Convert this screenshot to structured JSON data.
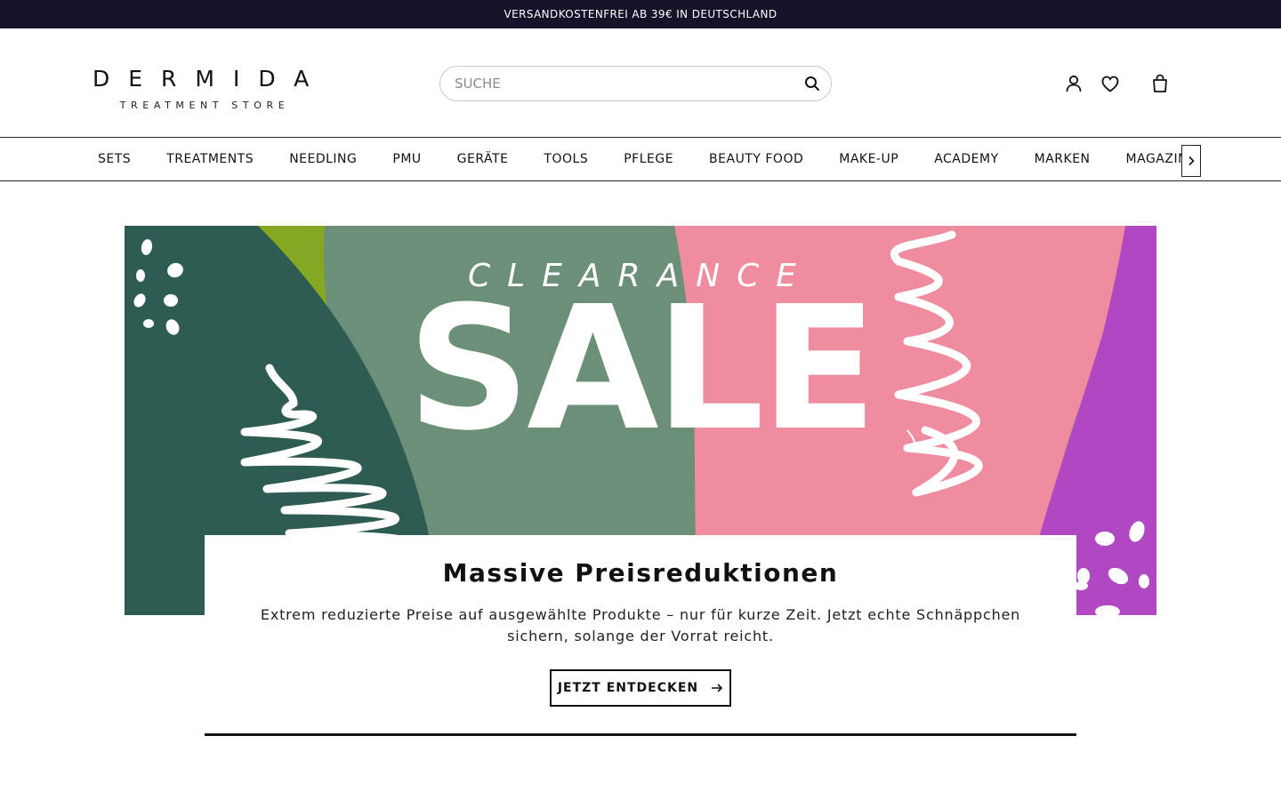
{
  "topbar": {
    "text": "VERSANDKOSTENFREI AB 39€ IN DEUTSCHLAND"
  },
  "logo": {
    "main": "DERMIDA",
    "sub": "TREATMENT STORE"
  },
  "search": {
    "placeholder": "SUCHE",
    "value": "",
    "icon": "search-icon"
  },
  "header_icons": [
    "user-icon",
    "heart-icon",
    "cart-icon"
  ],
  "nav": {
    "items": [
      "SETS",
      "TREATMENTS",
      "NEEDLING",
      "PMU",
      "GERÄTE",
      "TOOLS",
      "PFLEGE",
      "BEAUTY FOOD",
      "MAKE-UP",
      "ACADEMY",
      "MARKEN",
      "MAGAZIN"
    ],
    "more_icon": "chevron-right-icon"
  },
  "hero": {
    "kicker": "CLEARANCE",
    "title": "SALE",
    "colors": {
      "dark_green": "#2e5b52",
      "lime": "#84a822",
      "sage": "#6b8f77",
      "pink": "#f08ca0",
      "purple": "#b048c4"
    }
  },
  "card": {
    "title": "Massive Preisreduktionen",
    "text": "Extrem reduzierte Preise auf ausgewählte Produkte – nur für kurze Zeit. Jetzt echte Schnäppchen sichern, solange der Vorrat reicht.",
    "cta_label": "JETZT ENTDECKEN",
    "cta_icon": "arrow-right-icon"
  }
}
